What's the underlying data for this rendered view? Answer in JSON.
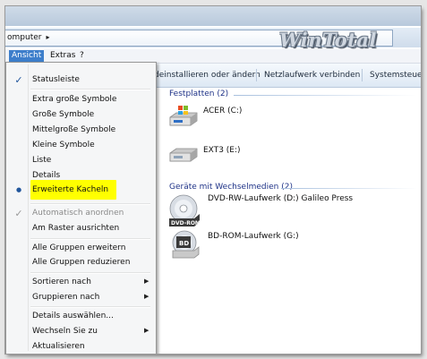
{
  "address": {
    "path_label": "omputer",
    "chevron": "▸",
    "refresh_icon": "⇆"
  },
  "logo": {
    "text": "WinTotal"
  },
  "menubar": {
    "items": [
      {
        "label": "Ansicht",
        "active": true
      },
      {
        "label": "Extras"
      },
      {
        "label": "?"
      }
    ]
  },
  "cmdbar": {
    "items": [
      {
        "label": "deinstallieren oder ändern"
      },
      {
        "label": "Netzlaufwerk verbinden"
      },
      {
        "label": "Systemsteuer"
      }
    ]
  },
  "groups": [
    {
      "title": "Festplatten (2)",
      "drives": [
        {
          "label": "ACER (C:)",
          "icon": "windows-drive-icon"
        },
        {
          "label": "EXT3 (E:)",
          "icon": "hard-drive-icon"
        }
      ]
    },
    {
      "title": "Geräte mit Wechselmedien (2)",
      "drives": [
        {
          "label": "DVD-RW-Laufwerk (D:) Galileo Press",
          "icon": "dvd-rom-drive-icon",
          "badge": "DVD-ROM"
        },
        {
          "label": "BD-ROM-Laufwerk (G:)",
          "icon": "bd-rom-drive-icon",
          "badge": "BD"
        }
      ]
    }
  ],
  "view_menu": {
    "check_mark": "✓",
    "radio_mark": "●",
    "submenu_arrow": "▶",
    "items": [
      {
        "label": "Statusleiste",
        "checked": true
      },
      {
        "label": "Extra große Symbole"
      },
      {
        "label": "Große Symbole"
      },
      {
        "label": "Mittelgroße Symbole"
      },
      {
        "label": "Kleine Symbole"
      },
      {
        "label": "Liste"
      },
      {
        "label": "Details"
      },
      {
        "label": "Erweiterte Kacheln",
        "selected": true,
        "highlighted": true,
        "highlight_color": "#ffff00"
      },
      {
        "label": "Automatisch anordnen",
        "checked": true,
        "disabled": true
      },
      {
        "label": "Am Raster ausrichten"
      },
      {
        "label": "Alle Gruppen erweitern"
      },
      {
        "label": "Alle Gruppen reduzieren"
      },
      {
        "label": "Sortieren nach",
        "submenu": true
      },
      {
        "label": "Gruppieren nach",
        "submenu": true
      },
      {
        "label": "Details auswählen..."
      },
      {
        "label": "Wechseln Sie zu",
        "submenu": true
      },
      {
        "label": "Aktualisieren"
      }
    ]
  },
  "colors": {
    "accent": "#3d7ecb",
    "group_heading": "#1e3287",
    "highlight": "#ffff00"
  }
}
